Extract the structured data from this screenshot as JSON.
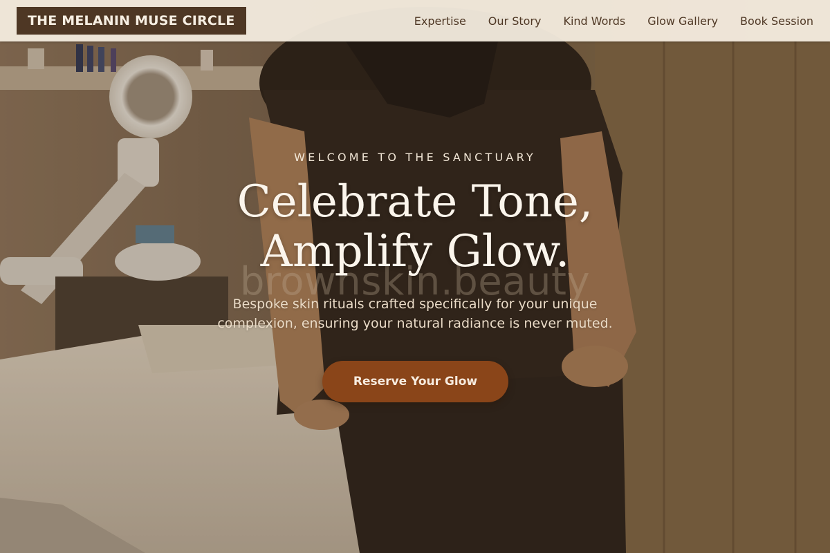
{
  "brand": {
    "logo_text": "THE MELANIN MUSE CIRCLE"
  },
  "nav": {
    "items": [
      {
        "label": "Expertise"
      },
      {
        "label": "Our Story"
      },
      {
        "label": "Kind Words"
      },
      {
        "label": "Glow Gallery"
      },
      {
        "label": "Book Session"
      }
    ]
  },
  "hero": {
    "eyebrow": "WELCOME TO THE SANCTUARY",
    "headline_line1": "Celebrate Tone,",
    "headline_line2": "Amplify Glow.",
    "watermark": "brownskin.beauty",
    "subtext": "Bespoke skin rituals crafted specifically for your unique complexion, ensuring your natural radiance is never muted.",
    "cta_label": "Reserve Your Glow"
  },
  "colors": {
    "header_bg": "#f5ede0",
    "logo_bg": "#4e3724",
    "nav_text": "#4e3724",
    "cta_bg": "#8a4519",
    "headline": "#fbf5ec"
  }
}
